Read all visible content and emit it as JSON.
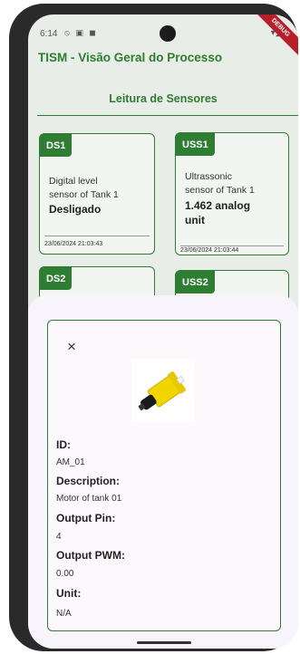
{
  "status_bar": {
    "time": "6:14",
    "left_icons": "⦸ ▣ ◼",
    "right_icons": "▾◢▮",
    "ribbon": "DEBUG"
  },
  "app": {
    "title": "TISM - Visão Geral do Processo"
  },
  "section": {
    "title": "Leitura de Sensores"
  },
  "sensors": [
    {
      "tag": "DS1",
      "desc_line1": "Digital level",
      "desc_line2": "sensor of Tank 1",
      "value_line1": "Desligado",
      "value_line2": "",
      "timestamp": "23/06/2024 21:03:43"
    },
    {
      "tag": "USS1",
      "desc_line1": "Ultrassonic",
      "desc_line2": "sensor of Tank 1",
      "value_line1": "1.462 analog",
      "value_line2": "unit",
      "timestamp": "23/06/2024 21:03:44"
    },
    {
      "tag": "DS2"
    },
    {
      "tag": "USS2"
    }
  ],
  "dialog": {
    "close_glyph": "×",
    "fields": [
      {
        "label": "ID:",
        "value": "AM_01"
      },
      {
        "label": "Description:",
        "value": "Motor of tank 01"
      },
      {
        "label": "Output Pin:",
        "value": "4"
      },
      {
        "label": "Output PWM:",
        "value": "0.00"
      },
      {
        "label": "Unit:",
        "value": "N/A"
      }
    ]
  },
  "colors": {
    "accent": "#2e7d32",
    "ribbon": "#b7202a",
    "motor_body": "#f2d400"
  }
}
